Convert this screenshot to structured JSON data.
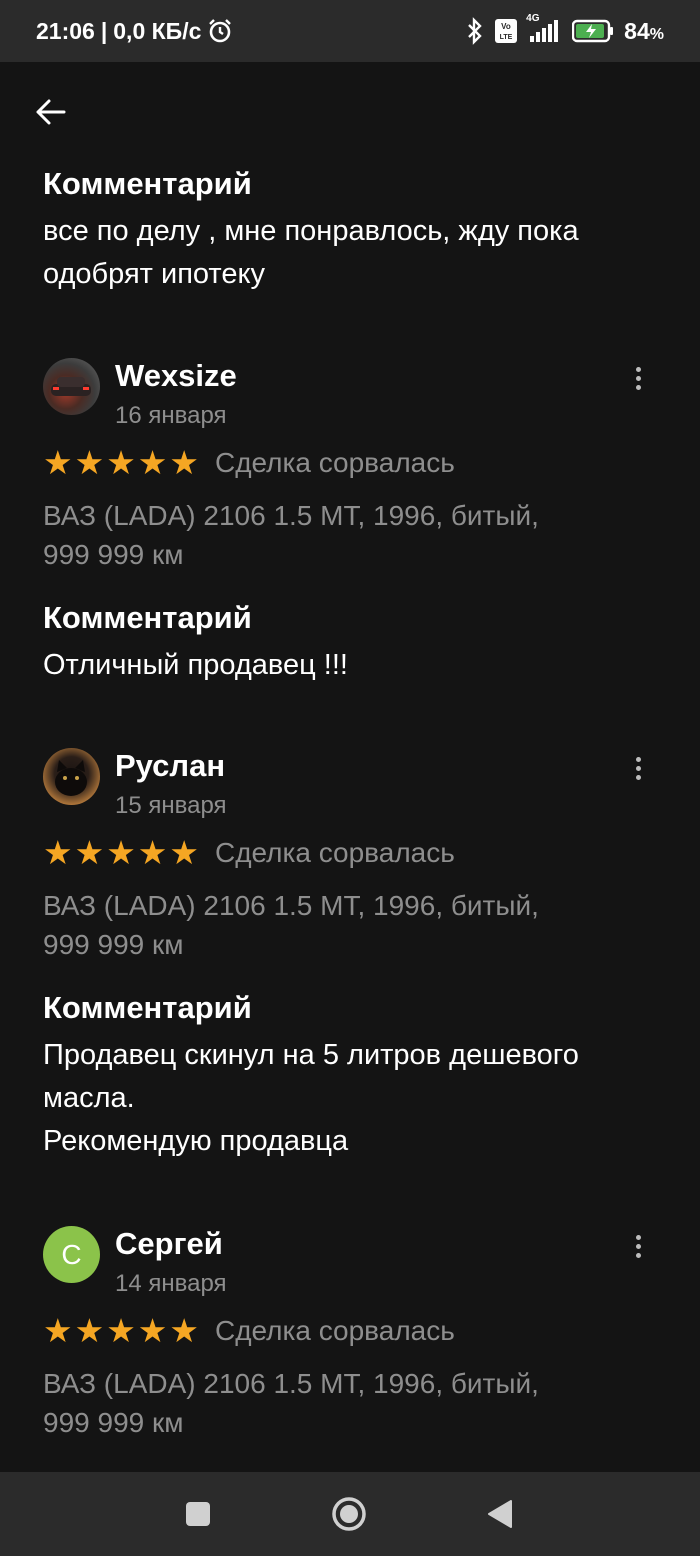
{
  "status_bar": {
    "time": "21:06",
    "separator": "|",
    "speed": "0,0 КБ/с",
    "alarm_icon": "alarm-clock-icon",
    "bluetooth_icon": "bluetooth-icon",
    "volte_icon": "volte-icon",
    "network_label": "4G",
    "signal_icon": "signal-bars-icon",
    "battery_icon": "battery-charging-icon",
    "battery_level": "84",
    "battery_unit": "%"
  },
  "header": {
    "back_icon": "arrow-left-icon"
  },
  "top_comment": {
    "title": "Комментарий",
    "lines": [
      "все по делу , мне понравлось, жду пока",
      "одобрят ипотеку"
    ]
  },
  "reviews": [
    {
      "name": "Wexsize",
      "date": "16 января",
      "avatar": "car-photo",
      "rating": 5,
      "status": "Сделка сорвалась",
      "car_lines": [
        "ВАЗ (LADA) 2106 1.5 MT, 1996, битый,",
        "999 999 км"
      ],
      "comment_title": "Комментарий",
      "comment_lines": [
        "Отличный продавец !!!"
      ]
    },
    {
      "name": "Руслан",
      "date": "15 января",
      "avatar": "cat-photo",
      "rating": 5,
      "status": "Сделка сорвалась",
      "car_lines": [
        "ВАЗ (LADA) 2106 1.5 MT, 1996, битый,",
        "999 999 км"
      ],
      "comment_title": "Комментарий",
      "comment_lines": [
        "Продавец скинул на 5 литров дешевого",
        "масла.",
        "Рекомендую продавца"
      ]
    },
    {
      "name": "Сергей",
      "date": "14 января",
      "avatar_letter": "С",
      "rating": 5,
      "status": "Сделка сорвалась",
      "car_lines": [
        "ВАЗ (LADA) 2106 1.5 MT, 1996, битый,",
        "999 999 км"
      ]
    }
  ],
  "colors": {
    "background": "#141414",
    "star": "#f5a623",
    "muted_text": "#8e8e8e",
    "avatar_green": "#8bc34a",
    "bars": "#2b2b2b"
  },
  "nav_bar": {
    "recents_icon": "square-icon",
    "home_icon": "circle-home-icon",
    "back_icon": "triangle-back-icon"
  }
}
